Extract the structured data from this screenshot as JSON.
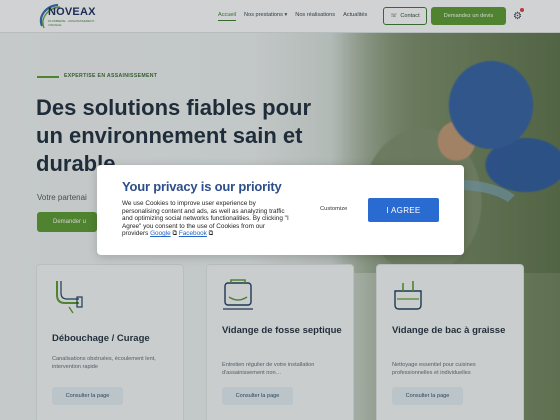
{
  "header": {
    "logo_name": "NOVEAX",
    "logo_tagline": "PLOMBERIE · ASSAINISSEMENT · VIDANGE",
    "nav": [
      {
        "label": "Accueil",
        "active": true
      },
      {
        "label": "Nos prestations ▾",
        "active": false
      },
      {
        "label": "Nos réalisations",
        "active": false
      },
      {
        "label": "Actualités",
        "active": false
      }
    ],
    "contact_label": "Contact",
    "quote_label": "Demandez un devis",
    "icons": {
      "contact": "phone-icon",
      "settings": "settings-icon"
    },
    "accent_color": "#5b9a2e"
  },
  "hero": {
    "eyebrow": "EXPERTISE EN ASSAINISSEMENT",
    "title": "Des solutions fiables pour un environnement sain et durable",
    "subtitle": "Votre partenai",
    "cta_label": "Demander u"
  },
  "cards": [
    {
      "icon": "pipe-wrench-icon",
      "title": "Débouchage / Curage",
      "desc": "Canalisations obstruées, écoulement lent, intervention rapide",
      "button": "Consulter la page"
    },
    {
      "icon": "septic-tank-icon",
      "title": "Vidange de fosse septique",
      "desc": "Entretien régulier de votre installation d'assainissement non…",
      "button": "Consulter la page"
    },
    {
      "icon": "grease-trap-icon",
      "title": "Vidange de bac à graisse",
      "desc": "Nettoyage essentiel pour cuisines professionnelles et individuelles",
      "button": "Consulter la page"
    }
  ],
  "cookie_modal": {
    "title": "Your privacy is our priority",
    "text": "We use Cookies to improve user experience by personalising content and ads, as well as analyzing traffic and optimizing social networks functionalities. By clicking \"I Agree\" you consent to the use of Cookies from our providers ",
    "link_google": "Google",
    "link_facebook": "Facebook",
    "customize_label": "Customize",
    "agree_label": "I AGREE",
    "agree_color": "#2a6bd1"
  }
}
